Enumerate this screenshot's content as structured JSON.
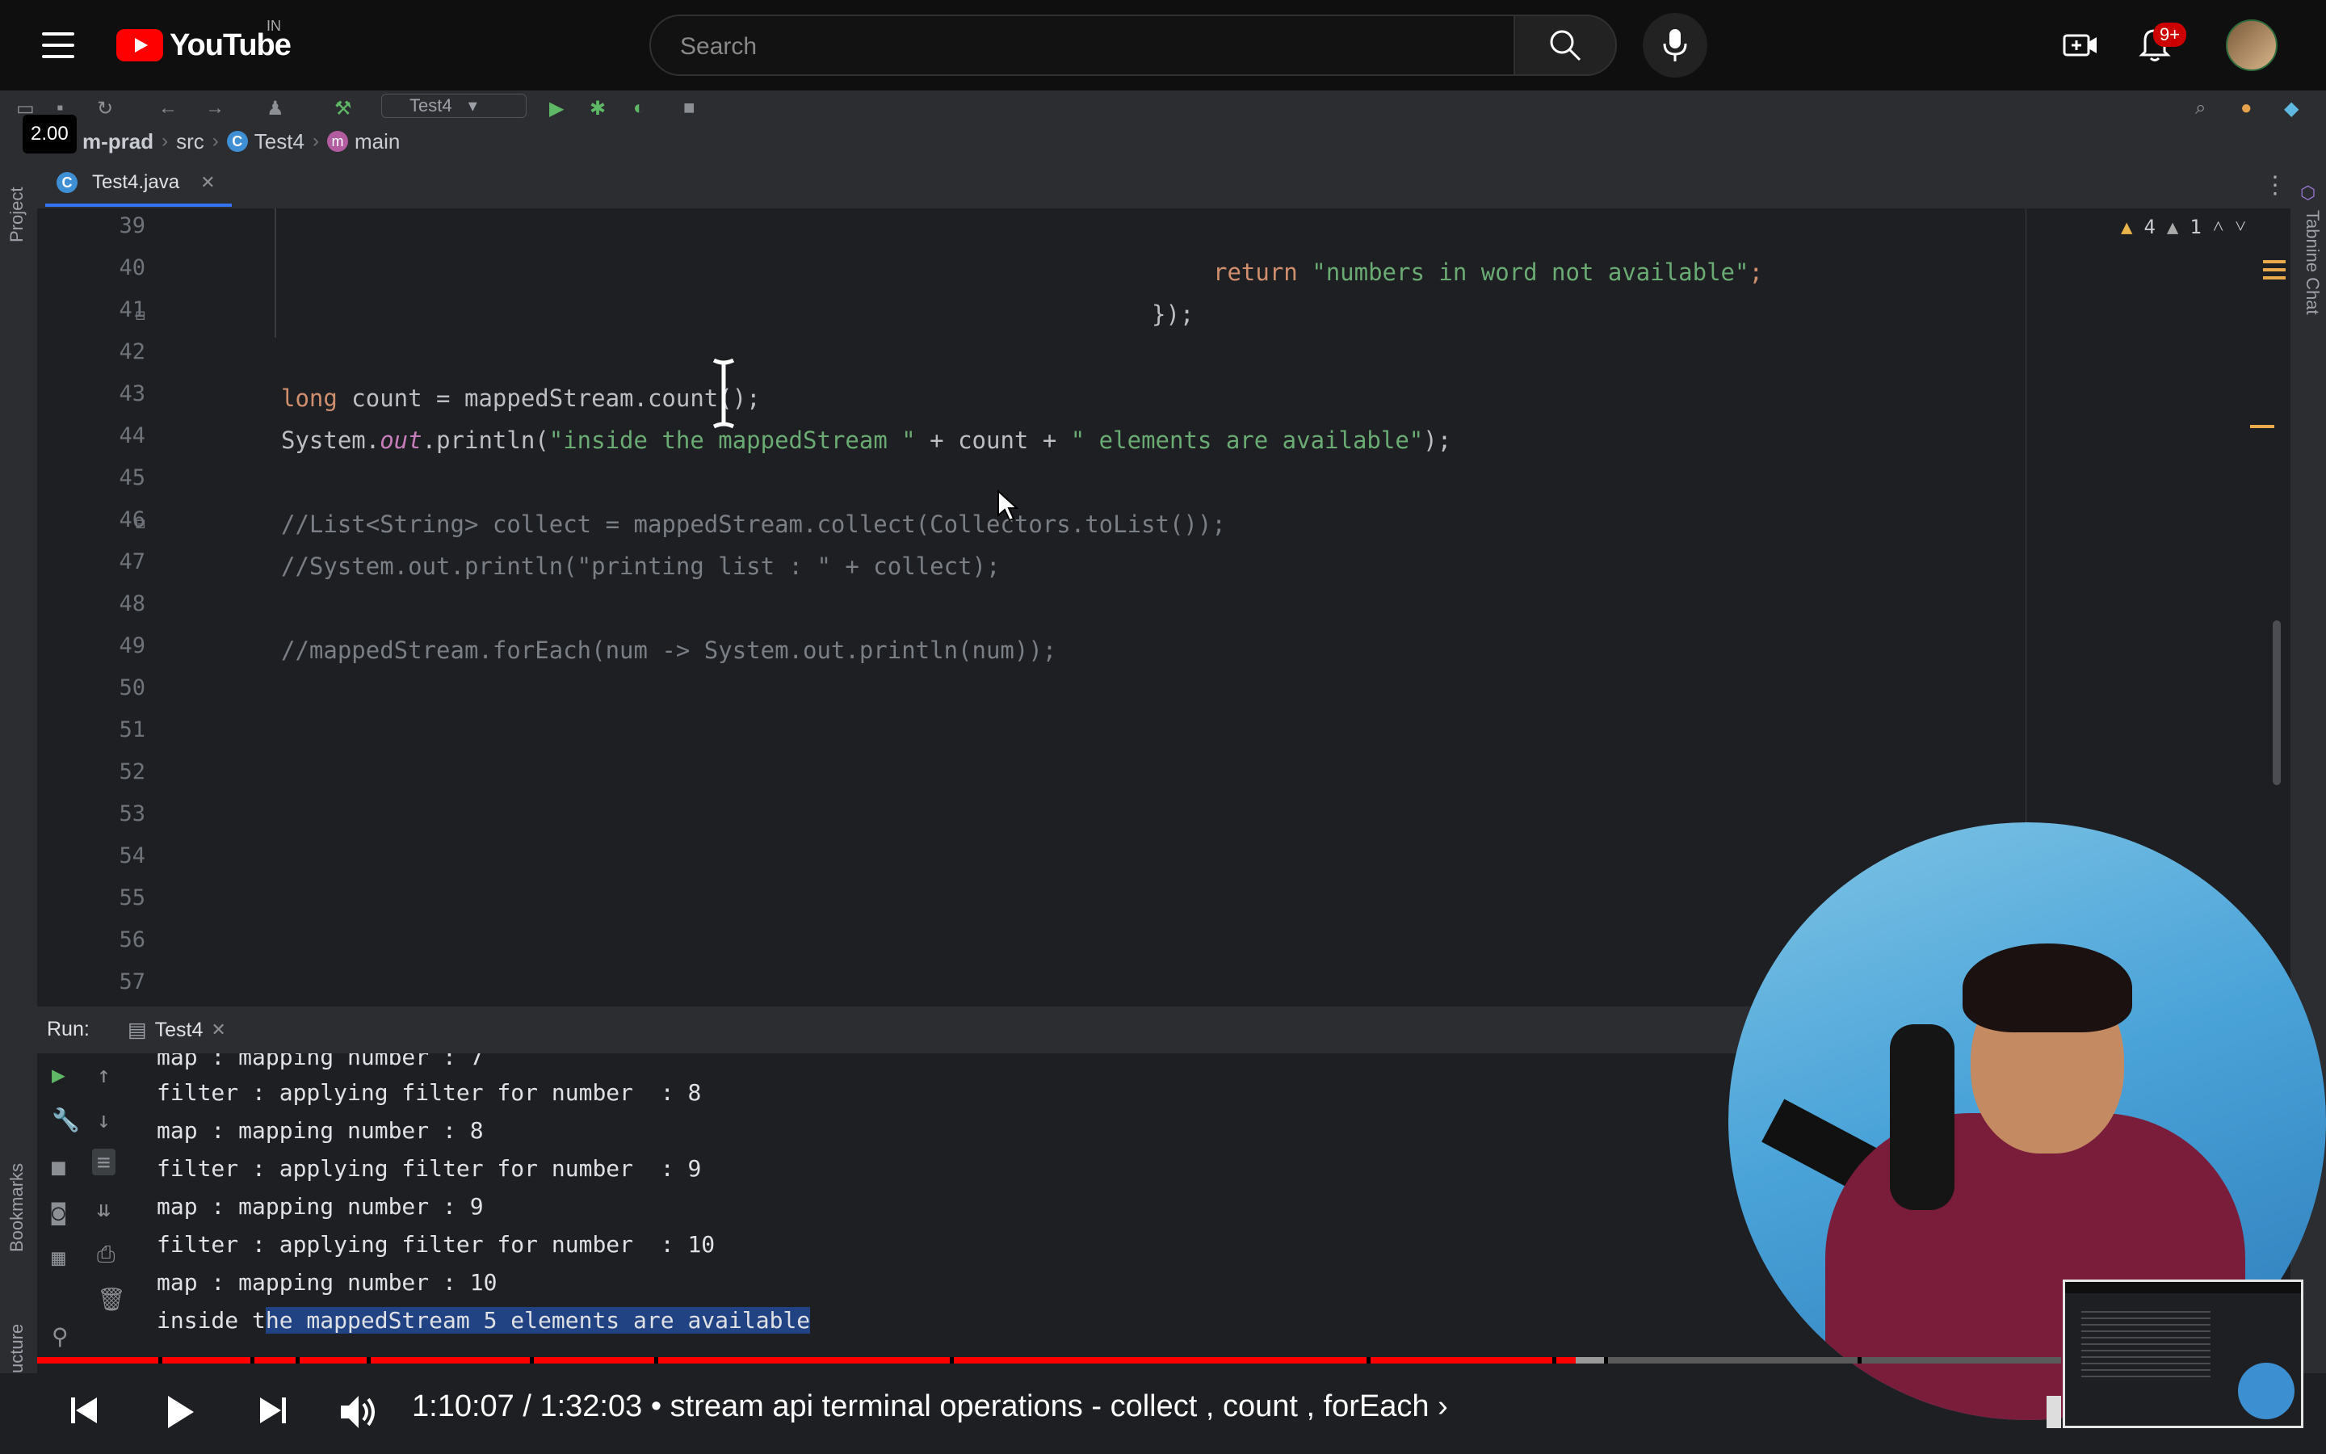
{
  "youtube": {
    "country_code": "IN",
    "search_placeholder": "Search",
    "notification_count": "9+",
    "logo_word": "YouTube"
  },
  "player": {
    "speed": "2.00",
    "progress_fraction": 0.76,
    "time_current": "1:10:07",
    "time_total": "1:32:03",
    "time_display": "1:10:07 / 1:32:03",
    "chapter_title": "• stream api terminal operations - collect , count , forEach ›"
  },
  "ide": {
    "run_config": "Test4",
    "breadcrumb": {
      "project": "m-prad",
      "folder": "src",
      "class": "Test4",
      "method": "main"
    },
    "tab": {
      "file": "Test4.java"
    },
    "side_labels": {
      "project": "Project",
      "bookmarks": "Bookmarks",
      "structure": "ucture",
      "tabnine": "Tabnine Chat"
    },
    "inspections": {
      "warnings": "4",
      "weak_warnings": "1"
    },
    "line_numbers": [
      "39",
      "40",
      "41",
      "42",
      "43",
      "44",
      "45",
      "46",
      "47",
      "48",
      "49",
      "50",
      "51",
      "52",
      "53",
      "54",
      "55",
      "56",
      "57"
    ],
    "code": {
      "l40_kw": "return",
      "l40_str": "\"numbers in word not available\"",
      "l40_end": ";",
      "l41": "});",
      "l43_kw": "long",
      "l43_rest": " count = mappedStream.count();",
      "l44_a": "System.",
      "l44_out": "out",
      "l44_b": ".println(",
      "l44_s1": "\"inside the mappedStream \"",
      "l44_c": " + count + ",
      "l44_s2": "\" elements are available\"",
      "l44_d": ");",
      "l46": "//List<String> collect = mappedStream.collect(Collectors.toList());",
      "l47": "//System.out.println(\"printing list : \" + collect);",
      "l49": "//mappedStream.forEach(num -> System.out.println(num));"
    },
    "run": {
      "label": "Run:",
      "tab": "Test4",
      "output": [
        "map : mapping number : 7",
        "filter : applying filter for number  : 8",
        "map : mapping number : 8",
        "filter : applying filter for number  : 9",
        "map : mapping number : 9",
        "filter : applying filter for number  : 10",
        "map : mapping number : 10"
      ],
      "last_plain": "inside t",
      "last_selected": "he mappedStream 5 elements are available"
    }
  },
  "colors": {
    "yt_red": "#ff0000",
    "progress_played": "#ff0000",
    "progress_buffered": "#9a9a9a",
    "selection": "#214283",
    "keyword": "#cf8e6d",
    "string": "#6aab73"
  }
}
